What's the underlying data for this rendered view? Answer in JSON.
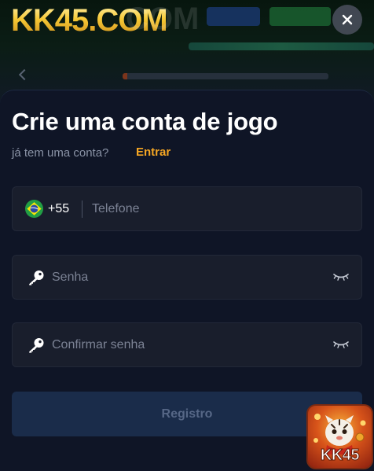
{
  "background": {
    "logo_text": "KK45.COM",
    "logo_echo": "COM"
  },
  "modal": {
    "title": "Crie uma conta de jogo",
    "subtitle": "já tem uma conta?",
    "login_link": "Entrar",
    "phone": {
      "flag_icon": "brazil-flag-icon",
      "country_code": "+55",
      "placeholder": "Telefone",
      "value": ""
    },
    "password": {
      "icon": "key-icon",
      "placeholder": "Senha",
      "value": "",
      "toggle_icon": "eye-closed-icon"
    },
    "confirm_password": {
      "icon": "key-icon",
      "placeholder": "Confirmar senha",
      "value": "",
      "toggle_icon": "eye-closed-icon"
    },
    "submit_label": "Registro",
    "close_icon": "close-icon"
  },
  "badge": {
    "label": "KK45",
    "icon": "fortune-tiger-game-icon"
  },
  "colors": {
    "page_bg": "#0a0f1c",
    "modal_bg": "#0f1526",
    "field_bg": "#191e2c",
    "accent_link": "#f5a623",
    "button_bg": "#1a2c4a",
    "button_text": "#566786",
    "logo_gold": "#f7c935"
  }
}
